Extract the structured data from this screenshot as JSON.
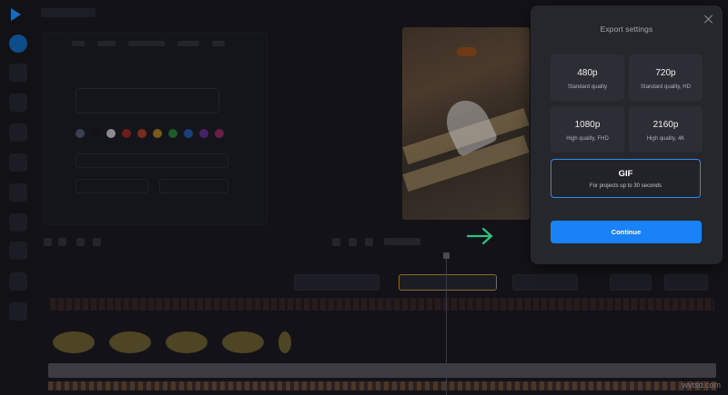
{
  "modal": {
    "title": "Export settings",
    "options": [
      {
        "quality": "480p",
        "desc": "Standard quality"
      },
      {
        "quality": "720p",
        "desc": "Standard quality, HD"
      },
      {
        "quality": "1080p",
        "desc": "High quality, FHD"
      },
      {
        "quality": "2160p",
        "desc": "High quality, 4K"
      }
    ],
    "gif": {
      "quality": "GIF",
      "desc": "For projects up to 30 seconds"
    },
    "continue_label": "Continue"
  },
  "colors": {
    "accent": "#1982f7",
    "selected_border": "#2d8cf0",
    "arrow": "#2ec27e"
  },
  "watermark": "wvtsd.com"
}
